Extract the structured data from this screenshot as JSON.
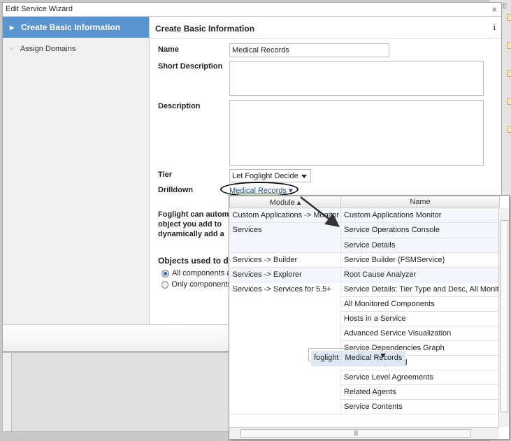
{
  "background": {
    "text": "ve E"
  },
  "dialog": {
    "title": "Edit Service Wizard",
    "close": "×"
  },
  "nav": {
    "items": [
      {
        "label": "Create Basic Information",
        "marker": "▸"
      },
      {
        "label": "Assign Domains",
        "marker": "○"
      }
    ]
  },
  "main": {
    "header": "Create Basic Information",
    "info": "i",
    "name_label": "Name",
    "name_value": "Medical Records",
    "short_desc_label": "Short Description",
    "desc_label": "Description",
    "tier_label": "Tier",
    "tier_value": "Let Foglight Decide",
    "drilldown_label": "Drilldown",
    "drilldown_value": "Medical Records ▾",
    "para": [
      "Foglight can autom",
      "object you add to",
      "dynamically add a"
    ],
    "objects_label": "Objects used to de",
    "radios": [
      {
        "label": "All components a",
        "checked": true
      },
      {
        "label": "Only components",
        "checked": false
      }
    ]
  },
  "dropdown": {
    "columns": [
      "Module ▴",
      "Name"
    ],
    "groups": [
      {
        "module": "Custom Applications -> Monitor",
        "names": [
          "Custom Applications Monitor"
        ]
      },
      {
        "module": "foglight",
        "names": [
          "Medical Records"
        ],
        "selected": true
      },
      {
        "module": "Services",
        "names": [
          "Service Operations Console",
          "Service Details"
        ]
      },
      {
        "module": "Services -> Builder",
        "names": [
          "Service Builder (FSMService)"
        ]
      },
      {
        "module": "Services -> Explorer",
        "names": [
          "Root Cause Analyzer"
        ]
      },
      {
        "module": "Services -> Services for 5.5+",
        "names": [
          "Service Details: Tier Type and Desc, All Monitored",
          "All Monitored Components",
          "Hosts in a Service",
          "Advanced Service Visualization",
          "Service Dependencies Graph",
          "Services Impacted",
          "Service Level Agreements",
          "Related Agents",
          "Service Contents"
        ]
      }
    ]
  }
}
